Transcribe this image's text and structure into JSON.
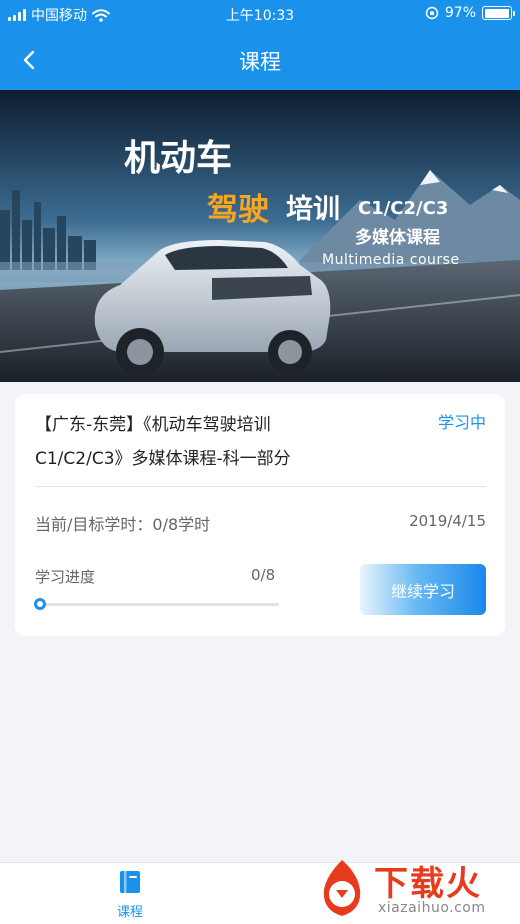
{
  "status_bar": {
    "carrier": "中国移动",
    "time": "上午10:33",
    "battery": "97%",
    "battery_level": 0.97
  },
  "nav": {
    "title": "课程"
  },
  "banner": {
    "line1": "机动车",
    "line2_highlight": "驾驶",
    "line2_rest": "培训",
    "line2_suffix": "C1/C2/C3",
    "line3": "多媒体课程",
    "line4": "Multimedia course"
  },
  "course": {
    "title_line1": "【广东-东莞】《机动车驾驶培训",
    "title_line2": "C1/C2/C3》多媒体课程-科一部分",
    "status": "学习中",
    "hours_label": "当前/目标学时：",
    "hours_value": "0/8学时",
    "date": "2019/4/15",
    "progress_label": "学习进度",
    "progress_value": "0/8",
    "progress_fraction": 0,
    "continue_label": "继续学习"
  },
  "tab_bar": {
    "items": [
      {
        "label": "课程",
        "icon": "book-icon",
        "active": true
      }
    ]
  },
  "watermark": {
    "brand": "下载火",
    "domain": "xiazaihuo.com"
  },
  "colors": {
    "primary": "#1a92ec",
    "background": "#f3f4f8",
    "highlight": "#f5a623"
  }
}
